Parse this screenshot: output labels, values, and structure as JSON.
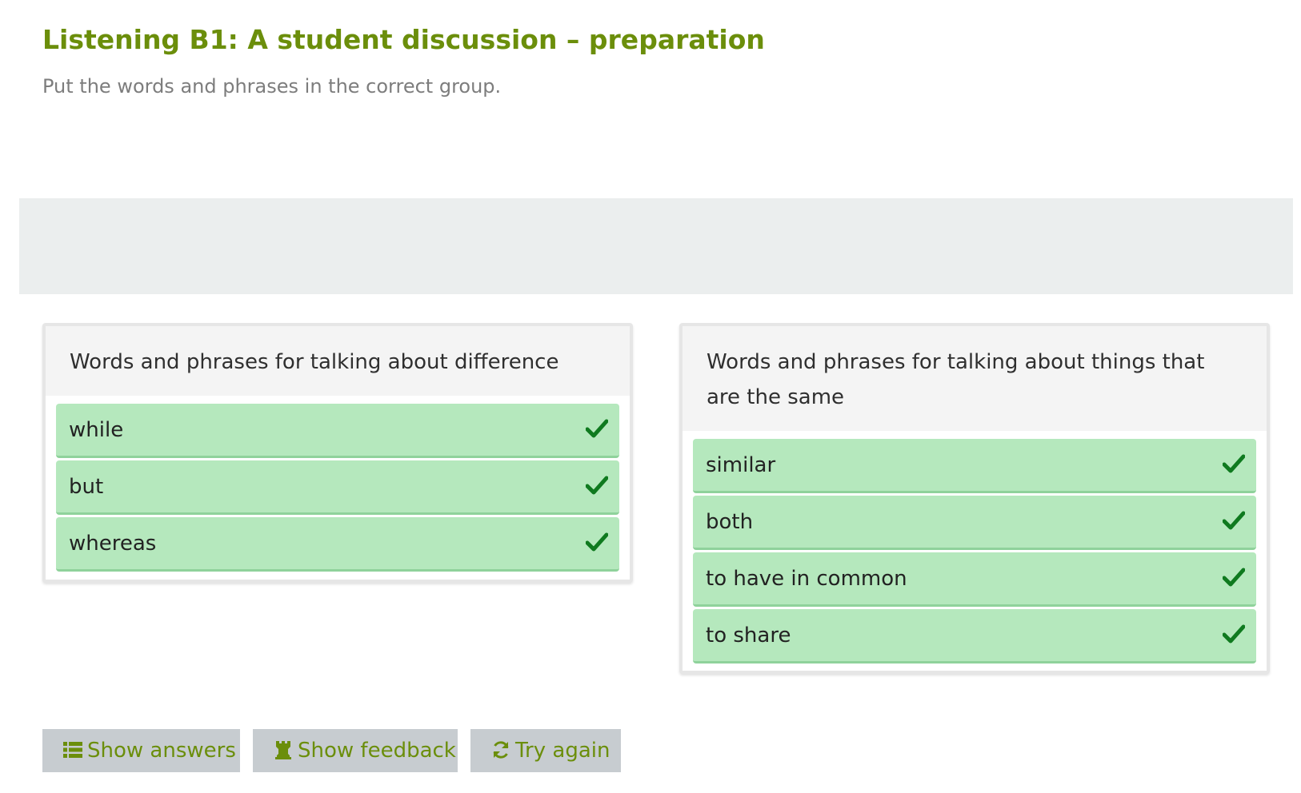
{
  "header": {
    "title": "Listening B1: A student discussion – preparation",
    "instructions": "Put the words and phrases in the correct group."
  },
  "groups": [
    {
      "label": "Words and phrases for talking about difference",
      "items": [
        "while",
        "but",
        "whereas"
      ]
    },
    {
      "label": "Words and phrases for talking about things that are the same",
      "items": [
        "similar",
        "both",
        "to have in common",
        "to share"
      ]
    }
  ],
  "item_status": "correct",
  "status_icon": "check-icon",
  "buttons": {
    "show_answers": "Show answers",
    "show_feedback": "Show feedback",
    "try_again": "Try again"
  },
  "colors": {
    "accent": "#6b8e0b",
    "correct_item_bg": "#b5e8bd",
    "check": "#0f7a1f",
    "button_bg": "#c7ccd0"
  }
}
